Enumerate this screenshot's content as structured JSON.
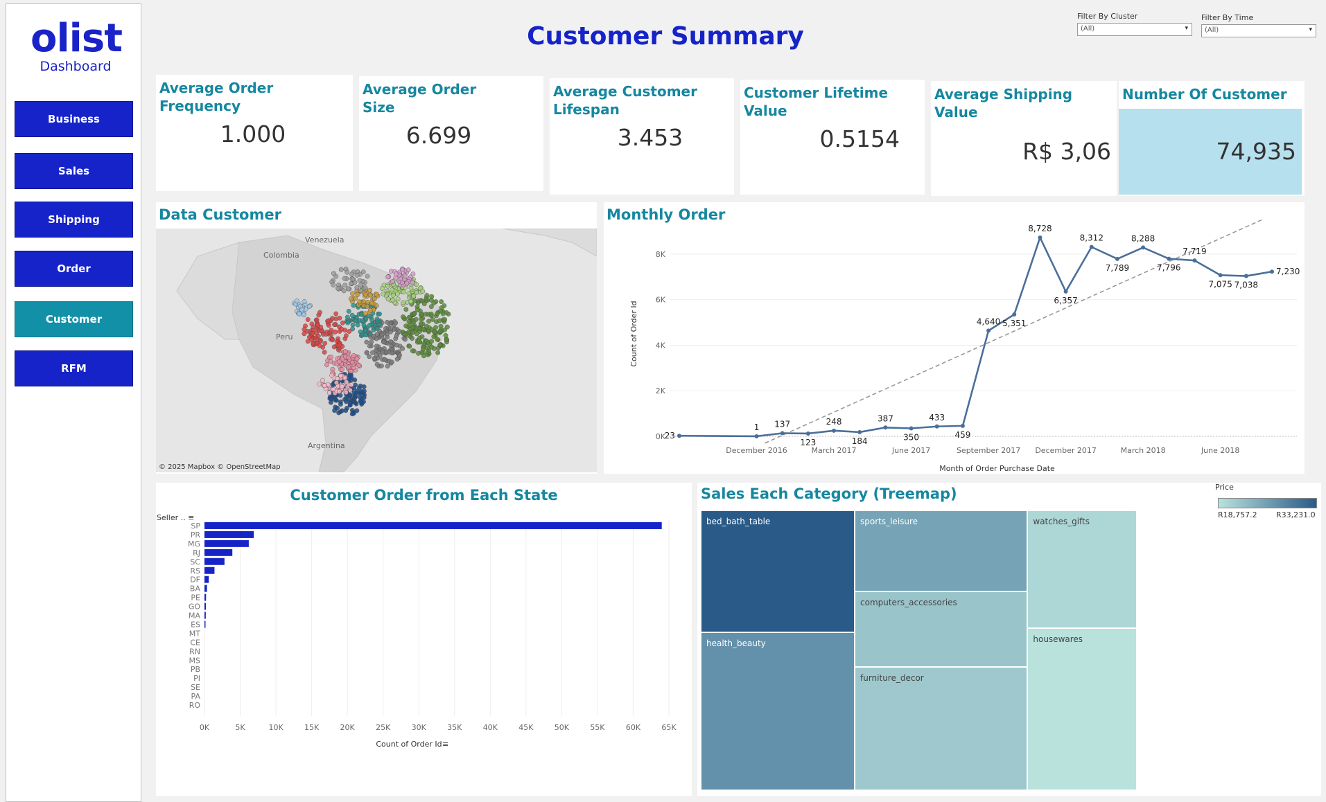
{
  "logo": {
    "word": "olist",
    "sub": "Dashboard"
  },
  "nav": [
    {
      "label": "Business",
      "active": false
    },
    {
      "label": "Sales",
      "active": false
    },
    {
      "label": "Shipping",
      "active": false
    },
    {
      "label": "Order",
      "active": false
    },
    {
      "label": "Customer",
      "active": true
    },
    {
      "label": "RFM",
      "active": false
    }
  ],
  "title": "Customer Summary",
  "filters": {
    "cluster": {
      "label": "Filter By Cluster",
      "value": "(All)"
    },
    "time": {
      "label": "Filter By Time",
      "value": "(All)"
    }
  },
  "kpis": [
    {
      "title": "Average Order Frequency",
      "value": "1.000"
    },
    {
      "title": "Average Order Size",
      "value": "6.699"
    },
    {
      "title": "Average Customer Lifespan",
      "value": "3.453"
    },
    {
      "title": "Customer Lifetime Value",
      "value": "0.5154"
    },
    {
      "title": "Average Shipping Value",
      "value": "R$ 3,06"
    },
    {
      "title": "Number Of Customer",
      "value": "74,935"
    }
  ],
  "map_panel": {
    "title": "Data Customer",
    "credit": "© 2025 Mapbox  © OpenStreetMap",
    "place_labels": [
      "Venezuela",
      "Colombia",
      "Peru",
      "Argentina"
    ]
  },
  "monthly_panel": {
    "title": "Monthly Order"
  },
  "state_panel": {
    "title": "Customer Order from Each State",
    "axis_header": "Seller .. "
  },
  "treemap_panel": {
    "title": "Sales Each Category (Treemap)",
    "legend_title": "Price",
    "legend_min": "R18,757.2",
    "legend_max": "R33,231.0",
    "colors": {
      "low": "#b9e2dd",
      "high": "#2a5a88"
    }
  },
  "colors": {
    "brand": "#1523c9",
    "accent": "#1687a0",
    "highlight": "#b6e0ee",
    "line": "#4a6f9a"
  },
  "chart_data": [
    {
      "type": "line",
      "title": "Monthly Order",
      "xlabel": "Month of Order Purchase Date",
      "ylabel": "Count of Order Id",
      "x_tick_labels": [
        "December 2016",
        "March 2017",
        "June 2017",
        "September 2017",
        "December 2017",
        "March 2018",
        "June 2018"
      ],
      "y_tick_labels": [
        "0K",
        "2K",
        "4K",
        "6K",
        "8K"
      ],
      "ylim": [
        0,
        9000
      ],
      "trend_line": true,
      "series": [
        {
          "x": [
            "2016-09",
            "2016-12",
            "2017-01",
            "2017-02",
            "2017-03",
            "2017-04",
            "2017-05",
            "2017-06",
            "2017-07",
            "2017-08",
            "2017-09",
            "2017-10",
            "2017-11",
            "2017-12",
            "2018-01",
            "2018-02",
            "2018-03",
            "2018-04",
            "2018-05",
            "2018-06",
            "2018-07",
            "2018-08"
          ],
          "values": [
            23,
            1,
            137,
            123,
            248,
            184,
            387,
            350,
            433,
            459,
            4640,
            5351,
            8728,
            6357,
            8312,
            7789,
            8288,
            7796,
            7719,
            7075,
            7038,
            7230
          ]
        }
      ]
    },
    {
      "type": "bar",
      "title": "Customer Order from Each State",
      "xlabel": "Count of Order Id",
      "orientation": "horizontal",
      "x_tick_labels": [
        "0K",
        "5K",
        "10K",
        "15K",
        "20K",
        "25K",
        "30K",
        "35K",
        "40K",
        "45K",
        "50K",
        "55K",
        "60K",
        "65K"
      ],
      "xlim": [
        0,
        65000
      ],
      "categories": [
        "SP",
        "PR",
        "MG",
        "RJ",
        "SC",
        "RS",
        "DF",
        "BA",
        "PE",
        "GO",
        "MA",
        "ES",
        "MT",
        "CE",
        "RN",
        "MS",
        "PB",
        "PI",
        "SE",
        "PA",
        "RO"
      ],
      "values": [
        64000,
        6900,
        6200,
        3900,
        2800,
        1400,
        600,
        350,
        220,
        200,
        180,
        120,
        0,
        0,
        0,
        0,
        0,
        0,
        0,
        0,
        0
      ]
    },
    {
      "type": "treemap",
      "title": "Sales Each Category (Treemap)",
      "categories": [
        "bed_bath_table",
        "health_beauty",
        "sports_leisure",
        "computers_accessories",
        "furniture_decor",
        "watches_gifts",
        "housewares"
      ],
      "values": [
        33231.0,
        27500,
        25500,
        22000,
        21500,
        20000,
        18757.2
      ]
    }
  ]
}
